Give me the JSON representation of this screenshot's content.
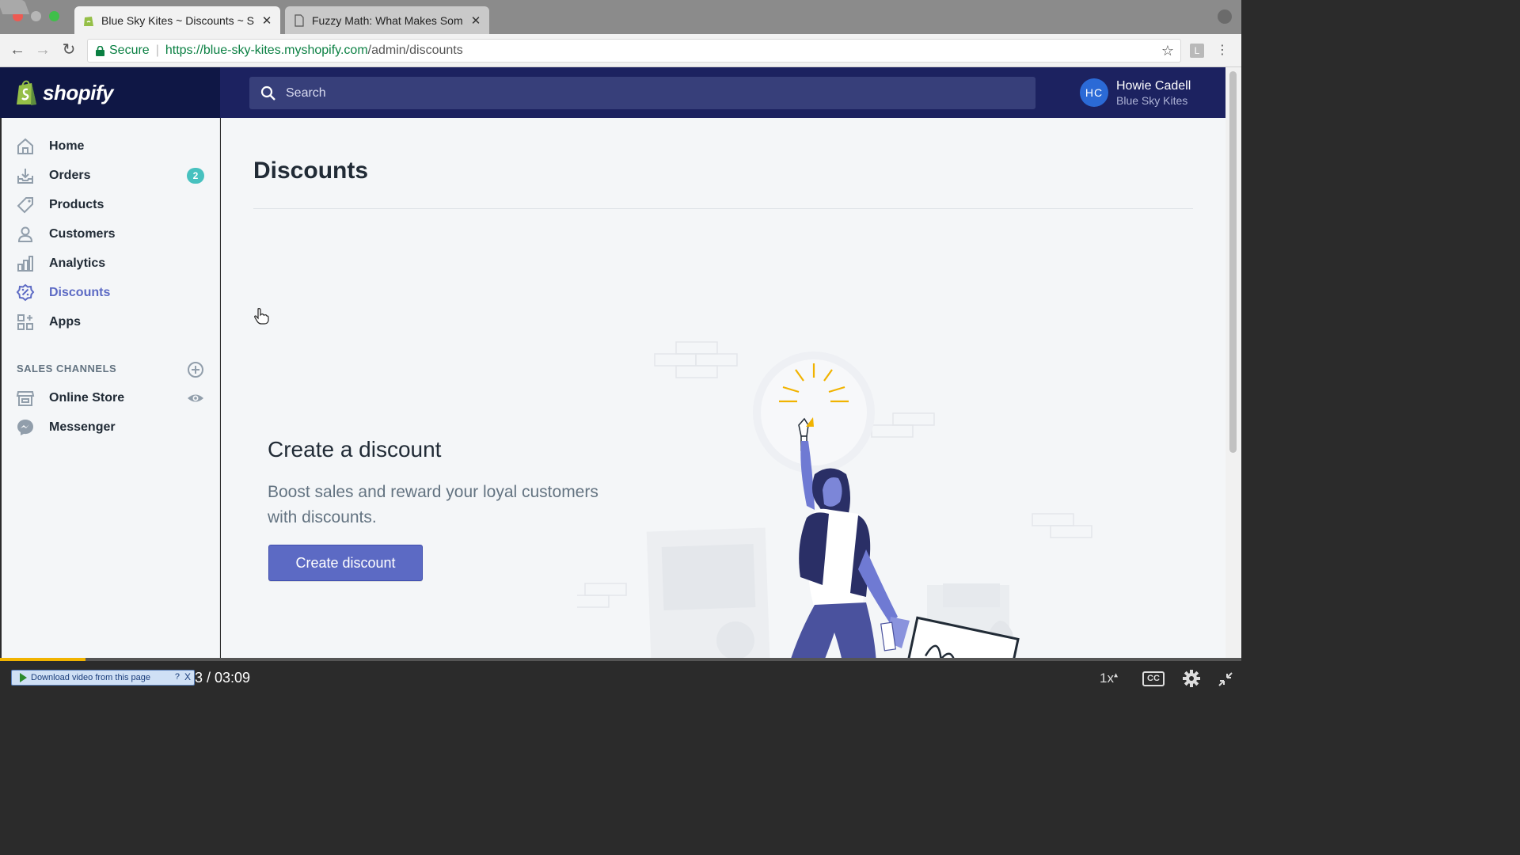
{
  "browser": {
    "tabs": [
      {
        "title": "Blue Sky Kites ~ Discounts ~ S",
        "active": true
      },
      {
        "title": "Fuzzy Math: What Makes Som",
        "active": false
      }
    ],
    "address": {
      "secure_label": "Secure",
      "url_host": "https://blue-sky-kites.myshopify.com",
      "url_path": "/admin/discounts"
    },
    "extension_label": "L"
  },
  "shopify": {
    "logo_text": "shopify",
    "search": {
      "placeholder": "Search"
    },
    "user": {
      "initials": "HC",
      "name": "Howie Cadell",
      "store": "Blue Sky Kites"
    }
  },
  "sidebar": {
    "items": [
      {
        "label": "Home",
        "icon": "home-icon"
      },
      {
        "label": "Orders",
        "icon": "orders-icon",
        "badge": "2"
      },
      {
        "label": "Products",
        "icon": "tag-icon"
      },
      {
        "label": "Customers",
        "icon": "person-icon"
      },
      {
        "label": "Analytics",
        "icon": "bar-chart-icon"
      },
      {
        "label": "Discounts",
        "icon": "discount-icon",
        "active": true
      },
      {
        "label": "Apps",
        "icon": "apps-icon"
      }
    ],
    "sales_channels_heading": "SALES CHANNELS",
    "channels": [
      {
        "label": "Online Store",
        "icon": "store-icon"
      },
      {
        "label": "Messenger",
        "icon": "messenger-icon"
      }
    ]
  },
  "main": {
    "title": "Discounts",
    "empty_state": {
      "heading": "Create a discount",
      "text": "Boost sales and reward your loyal customers with discounts.",
      "button": "Create discount"
    }
  },
  "video": {
    "download_label": "Download video from this page",
    "download_help": "?",
    "download_close": "X",
    "time": "3 / 03:09",
    "speed": "1x",
    "cc_label": "CC",
    "progress_fraction": 0.069
  },
  "colors": {
    "topbar": "#1c2260",
    "accent": "#5c6ac4",
    "badge": "#47c1bf",
    "sidebar_bg": "#f4f6f8"
  }
}
